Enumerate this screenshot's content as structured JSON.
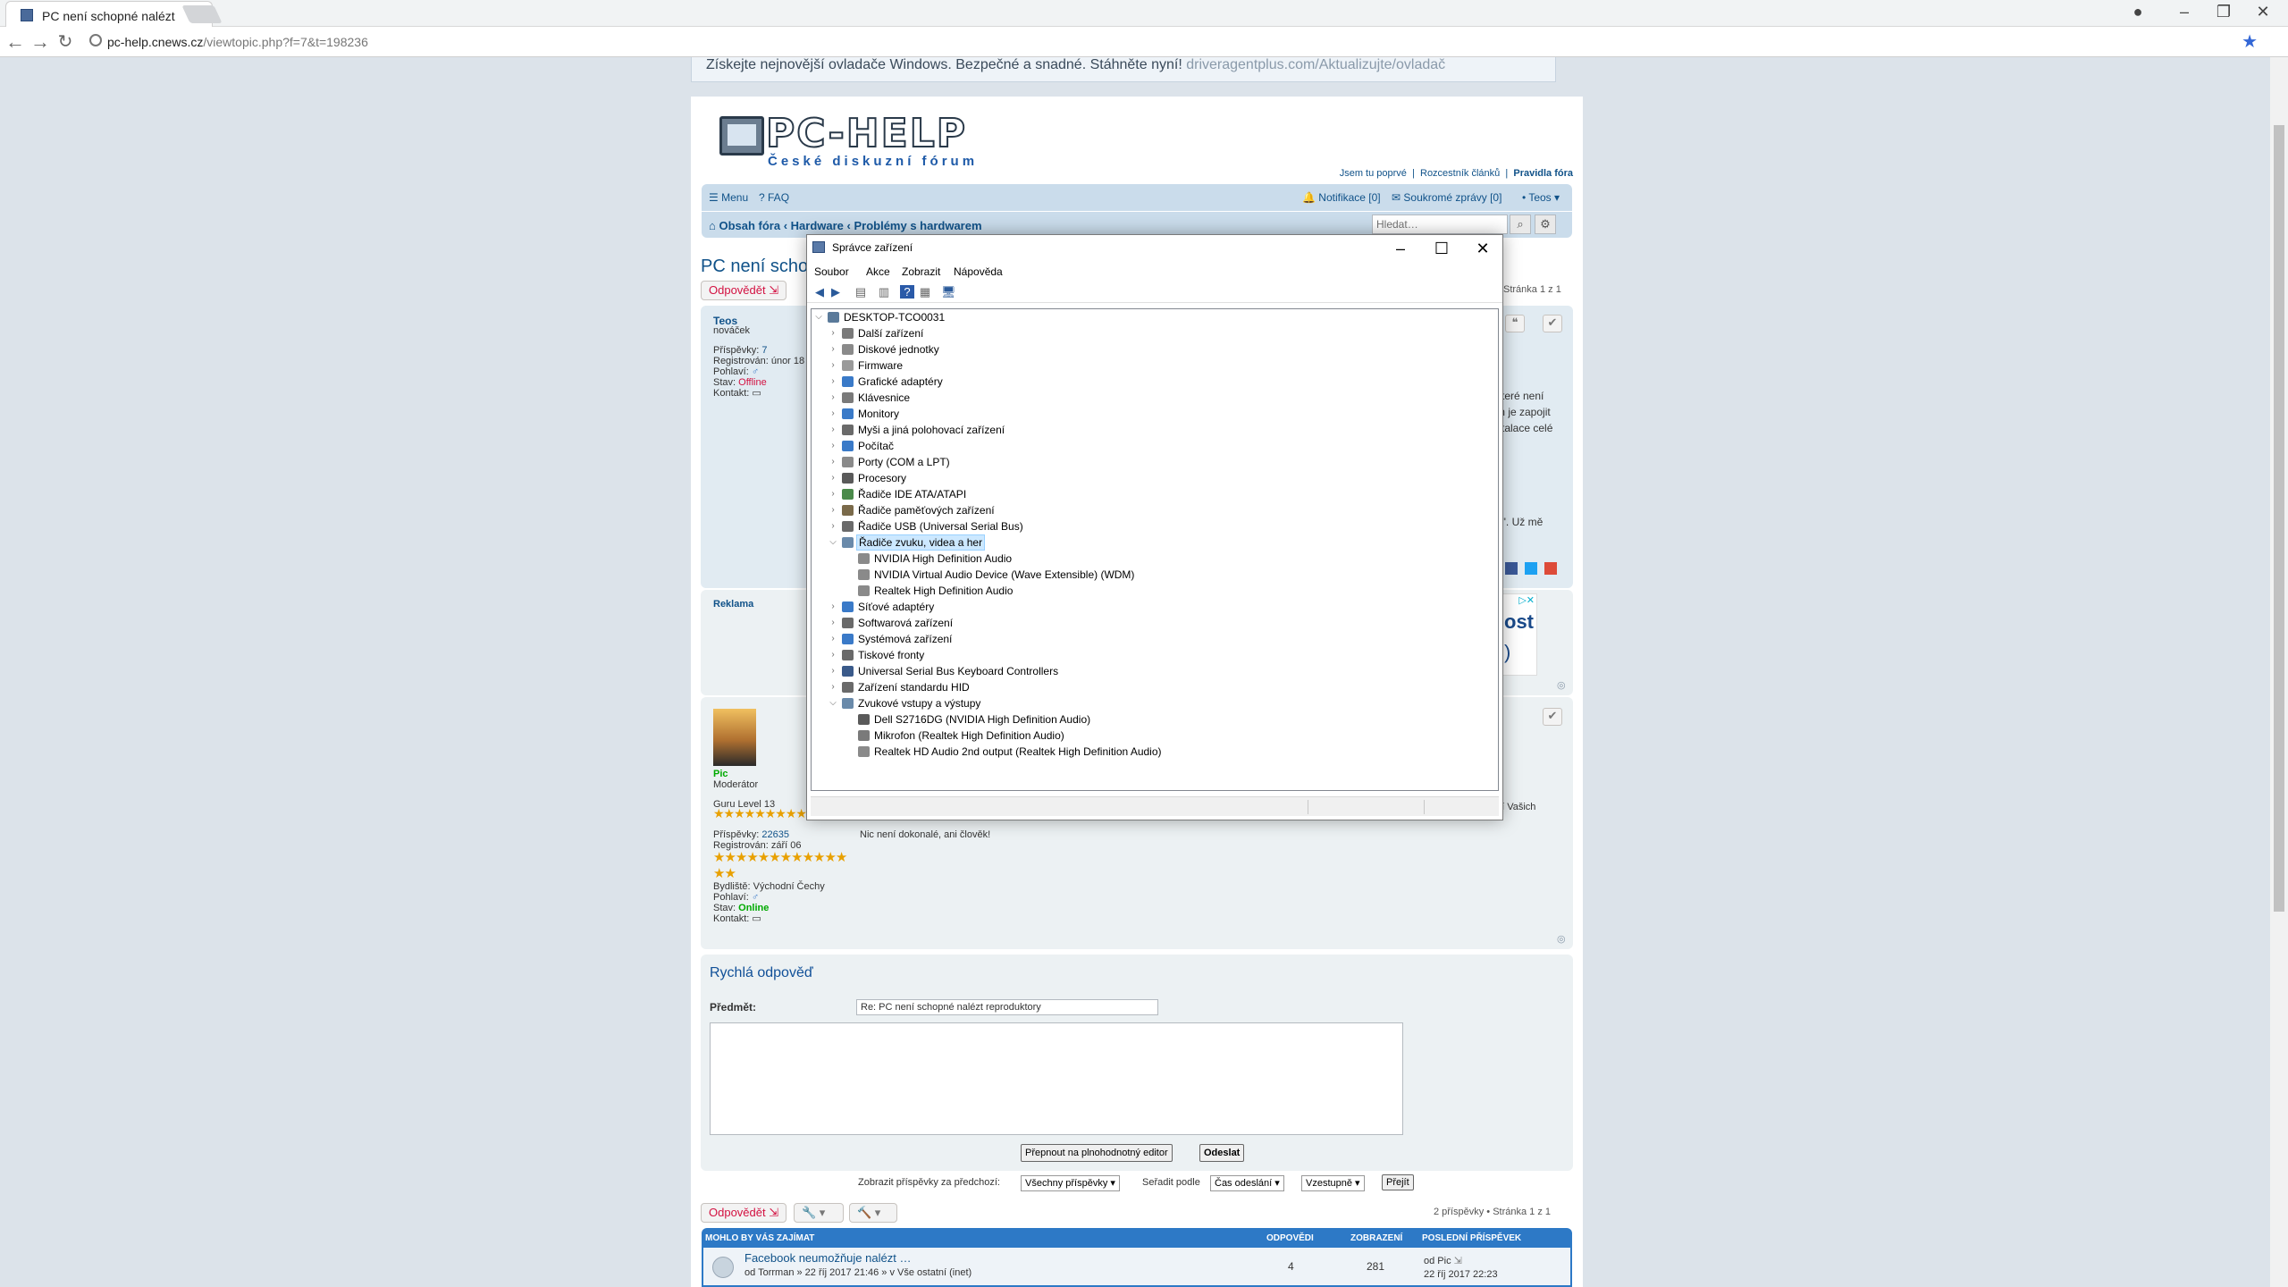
{
  "browser": {
    "tab_title": "PC není schopné nalézt r",
    "url_host": "pc-help.cnews.cz",
    "url_path": "/viewtopic.php?f=7&t=198236"
  },
  "ad_top": {
    "text": "Získejte nejnovější ovladače Windows. Bezpečné a snadné. Stáhněte nyní! ",
    "link": "driveragentplus.com/Aktualizujte/ovladač"
  },
  "logo": {
    "name": "PC-HELP",
    "sub": "České diskuzní fórum"
  },
  "toplinks": {
    "a": "Jsem tu poprvé",
    "b": "Rozcestník článků",
    "c": "Pravidla fóra"
  },
  "navbar": {
    "menu": "Menu",
    "faq": "FAQ",
    "notifications": "Notifikace [0]",
    "messages": "Soukromé zprávy [0]",
    "user": "Teos"
  },
  "breadcrumbs": {
    "home": "Obsah fóra",
    "hardware": "Hardware",
    "forum": "Problémy s hardwarem"
  },
  "search": {
    "placeholder": "Hledat…"
  },
  "topic": {
    "title": "PC není schop",
    "reply_btn": "Odpovědět",
    "pagination": "Stránka 1 z 1"
  },
  "post1": {
    "author": "Teos",
    "rank": "nováček",
    "posts_label": "Příspěvky:",
    "posts": "7",
    "reg_label": "Registrován:",
    "reg": "únor 18",
    "sex_label": "Pohlaví:",
    "status_label": "Stav:",
    "status": "Offline",
    "contact_label": "Kontakt:",
    "text1": "které není",
    "text2": "m je zapojit",
    "text3": "stalace celé",
    "text4": "é\". Už mě"
  },
  "reklama": {
    "label": "Reklama",
    "ad_text": "ost",
    "ad_text2": ")"
  },
  "post2": {
    "author": "Pic",
    "rank": "Moderátor",
    "guru": "Guru Level 13",
    "posts_label": "Příspěvky:",
    "posts": "22635",
    "reg_label": "Registrován:",
    "reg": "září 06",
    "city_label": "Bydliště:",
    "city": "Východní Čechy",
    "sex_label": "Pohlaví:",
    "status_label": "Stav:",
    "status": "Online",
    "contact_label": "Kontakt:",
    "text": "Nic není dokonalé, ani člověk!",
    "text_side": "ní Vašich"
  },
  "quick_reply": {
    "heading": "Rychlá odpověď",
    "subject_label": "Předmět:",
    "subject": "Re: PC není schopné nalézt reproduktory",
    "switch_btn": "Přepnout na plnohodnotný editor",
    "send_btn": "Odeslat"
  },
  "sort": {
    "show_label": "Zobrazit příspěvky za předchozí:",
    "show": "Všechny příspěvky",
    "sort_label": "Seřadit podle",
    "sort": "Čas odeslání",
    "order": "Vzestupně",
    "go": "Přejít"
  },
  "bottom": {
    "count": "2 příspěvky • Stránka 1 z 1"
  },
  "similar": {
    "header": "MOHLO BY VÁS ZAJÍMAT",
    "col_replies": "ODPOVĚDI",
    "col_views": "ZOBRAZENÍ",
    "col_last": "POSLEDNÍ PŘÍSPĚVEK",
    "row_title": "Facebook neumožňuje nalézt …",
    "row_meta": "od Torrman » 22 říj 2017 21:46 » v Vše ostatní (inet)",
    "row_replies": "4",
    "row_views": "281",
    "row_last_by": "od Pic",
    "row_last_date": "22 říj 2017 22:23"
  },
  "device_manager": {
    "title": "Správce zařízení",
    "menu": [
      "Soubor",
      "Akce",
      "Zobrazit",
      "Nápověda"
    ],
    "root": "DESKTOP-TCO0031",
    "nodes": [
      {
        "label": "Další zařízení",
        "color": "#7a7a7a"
      },
      {
        "label": "Diskové jednotky",
        "color": "#8a8a8a"
      },
      {
        "label": "Firmware",
        "color": "#9a9a9a"
      },
      {
        "label": "Grafické adaptéry",
        "color": "#3a7ac8"
      },
      {
        "label": "Klávesnice",
        "color": "#7a7a7a"
      },
      {
        "label": "Monitory",
        "color": "#3a7ac8"
      },
      {
        "label": "Myši a jiná polohovací zařízení",
        "color": "#6a6a6a"
      },
      {
        "label": "Počítač",
        "color": "#3a7ac8"
      },
      {
        "label": "Porty (COM a LPT)",
        "color": "#8a8a8a"
      },
      {
        "label": "Procesory",
        "color": "#5a5a5a"
      },
      {
        "label": "Řadiče IDE ATA/ATAPI",
        "color": "#4a8a4a"
      },
      {
        "label": "Řadiče paměťových zařízení",
        "color": "#7a6a4a"
      },
      {
        "label": "Řadiče USB (Universal Serial Bus)",
        "color": "#6a6a6a"
      },
      {
        "label": "Řadiče zvuku, videa a her",
        "color": "#6a8aaa"
      },
      {
        "label": "NVIDIA High Definition Audio",
        "color": "#8a8a8a"
      },
      {
        "label": "NVIDIA Virtual Audio Device (Wave Extensible) (WDM)",
        "color": "#8a8a8a"
      },
      {
        "label": "Realtek High Definition Audio",
        "color": "#8a8a8a"
      },
      {
        "label": "Síťové adaptéry",
        "color": "#3a7ac8"
      },
      {
        "label": "Softwarová zařízení",
        "color": "#6a6a6a"
      },
      {
        "label": "Systémová zařízení",
        "color": "#3a7ac8"
      },
      {
        "label": "Tiskové fronty",
        "color": "#6a6a6a"
      },
      {
        "label": "Universal Serial Bus Keyboard Controllers",
        "color": "#3a5a8a"
      },
      {
        "label": "Zařízení standardu HID",
        "color": "#6a6a6a"
      },
      {
        "label": "Zvukové vstupy a výstupy",
        "color": "#6a8aaa"
      },
      {
        "label": "Dell S2716DG (NVIDIA High Definition Audio)",
        "color": "#5a5a5a"
      },
      {
        "label": "Mikrofon (Realtek High Definition Audio)",
        "color": "#7a7a7a"
      },
      {
        "label": "Realtek HD Audio 2nd output (Realtek High Definition Audio)",
        "color": "#8a8a8a"
      }
    ]
  }
}
